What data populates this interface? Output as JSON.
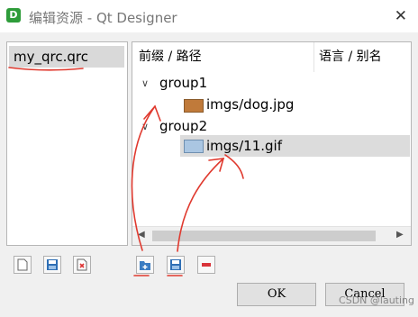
{
  "window": {
    "title": "编辑资源 - Qt Designer",
    "app_icon_letter": "D",
    "close_glyph": "✕"
  },
  "resource_files": [
    {
      "name": "my_qrc.qrc"
    }
  ],
  "tree": {
    "headers": {
      "prefix_path": "前缀 / 路径",
      "language_alias": "语言 / 别名"
    },
    "groups": [
      {
        "name": "group1",
        "files": [
          {
            "path": "imgs/dog.jpg"
          }
        ]
      },
      {
        "name": "group2",
        "files": [
          {
            "path": "imgs/11.gif"
          }
        ]
      }
    ]
  },
  "buttons": {
    "ok": "OK",
    "cancel": "Cancel"
  },
  "icons": {
    "left_toolbar": [
      "new-file-icon",
      "save-file-icon",
      "remove-file-icon"
    ],
    "right_toolbar": [
      "add-prefix-icon",
      "add-files-icon",
      "remove-minus-icon"
    ]
  },
  "watermark": "CSDN @lauting",
  "annotation_color": "#e03a2f"
}
